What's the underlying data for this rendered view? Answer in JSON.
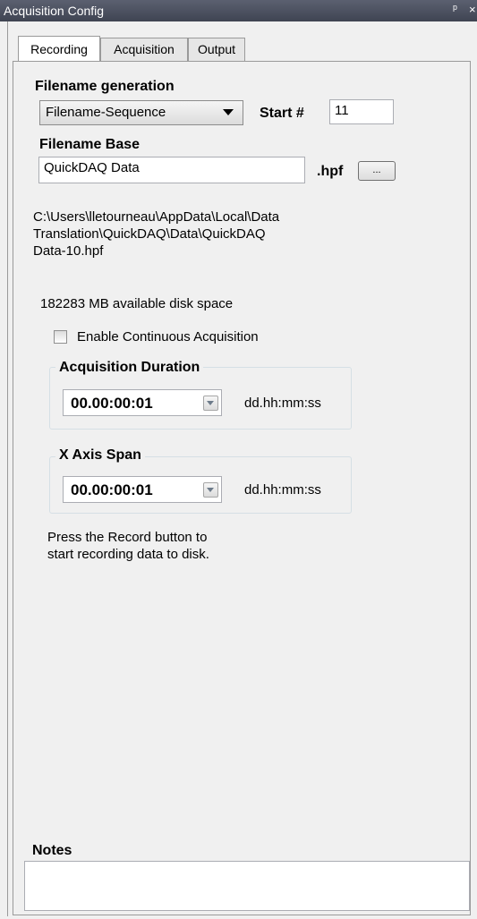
{
  "window": {
    "title": "Acquisition Config",
    "pin_glyph": "ᵖ",
    "close_glyph": "×"
  },
  "tabs": [
    {
      "label": "Recording",
      "active": true
    },
    {
      "label": "Acquisition",
      "active": false
    },
    {
      "label": "Output",
      "active": false
    }
  ],
  "recording": {
    "filename_generation_label": "Filename generation",
    "filename_mode": "Filename-Sequence",
    "start_label": "Start #",
    "start_value": "11",
    "filename_base_label": "Filename Base",
    "filename_base_value": "QuickDAQ Data",
    "extension": ".hpf",
    "browse_label": "...",
    "path_line1": "C:\\Users\\lletourneau\\AppData\\Local\\Data",
    "path_line2": "Translation\\QuickDAQ\\Data\\QuickDAQ",
    "path_line3": "Data-10.hpf",
    "disk_space": "182283 MB available disk space",
    "continuous_label": "Enable Continuous Acquisition",
    "continuous_checked": false,
    "duration_group": "Acquisition Duration",
    "duration_value": "00.00:00:01",
    "duration_unit": "dd.hh:mm:ss",
    "span_group": "X Axis Span",
    "span_value": "00.00:00:01",
    "span_unit": "dd.hh:mm:ss",
    "hint_line1": "Press the Record button to",
    "hint_line2": "start recording data to disk.",
    "notes_label": "Notes",
    "notes_value": ""
  }
}
